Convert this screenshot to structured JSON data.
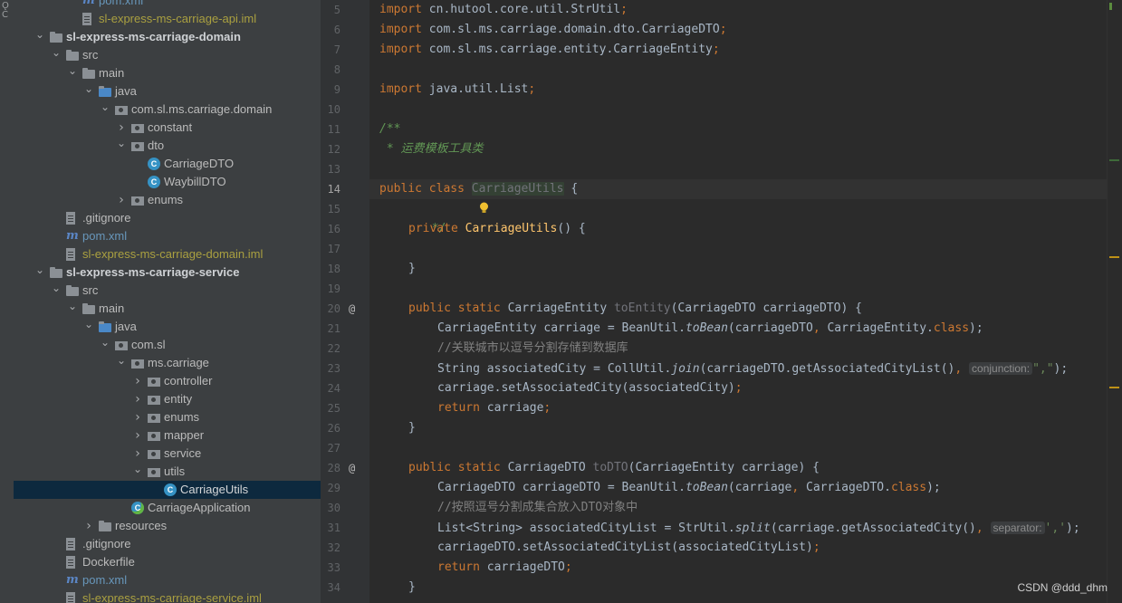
{
  "tool_strip": {
    "glyph": "Ǫ C"
  },
  "project_tree": {
    "rows": [
      {
        "label": "pom.xml",
        "icon": "maven-icon",
        "style": "blue"
      },
      {
        "label": "sl-express-ms-carriage-api.iml",
        "icon": "iml-file-icon",
        "style": "yellow"
      },
      {
        "label": "sl-express-ms-carriage-domain",
        "icon": "module-folder-icon",
        "style": "bold",
        "expanded": true
      },
      {
        "label": "src",
        "icon": "folder-icon",
        "expanded": true
      },
      {
        "label": "main",
        "icon": "folder-icon",
        "expanded": true
      },
      {
        "label": "java",
        "icon": "source-folder-icon",
        "expanded": true
      },
      {
        "label": "com.sl.ms.carriage.domain",
        "icon": "package-icon",
        "expanded": true
      },
      {
        "label": "constant",
        "icon": "package-icon",
        "expanded": false
      },
      {
        "label": "dto",
        "icon": "package-icon",
        "expanded": true
      },
      {
        "label": "CarriageDTO",
        "icon": "class-icon"
      },
      {
        "label": "WaybillDTO",
        "icon": "class-icon"
      },
      {
        "label": "enums",
        "icon": "package-icon",
        "expanded": false
      },
      {
        "label": ".gitignore",
        "icon": "gitignore-file-icon"
      },
      {
        "label": "pom.xml",
        "icon": "maven-icon",
        "style": "blue"
      },
      {
        "label": "sl-express-ms-carriage-domain.iml",
        "icon": "iml-file-icon",
        "style": "yellow"
      },
      {
        "label": "sl-express-ms-carriage-service",
        "icon": "module-folder-icon",
        "style": "bold",
        "expanded": true
      },
      {
        "label": "src",
        "icon": "folder-icon",
        "expanded": true
      },
      {
        "label": "main",
        "icon": "folder-icon",
        "expanded": true
      },
      {
        "label": "java",
        "icon": "source-folder-icon",
        "expanded": true
      },
      {
        "label": "com.sl",
        "icon": "package-icon",
        "expanded": true
      },
      {
        "label": "ms.carriage",
        "icon": "package-icon",
        "expanded": true
      },
      {
        "label": "controller",
        "icon": "package-icon",
        "expanded": false
      },
      {
        "label": "entity",
        "icon": "package-icon",
        "expanded": false
      },
      {
        "label": "enums",
        "icon": "package-icon",
        "expanded": false
      },
      {
        "label": "mapper",
        "icon": "package-icon",
        "expanded": false
      },
      {
        "label": "service",
        "icon": "package-icon",
        "expanded": false
      },
      {
        "label": "utils",
        "icon": "package-icon",
        "expanded": true
      },
      {
        "label": "CarriageUtils",
        "icon": "class-icon",
        "selected": true
      },
      {
        "label": "CarriageApplication",
        "icon": "spring-app-class-icon"
      },
      {
        "label": "resources",
        "icon": "resources-folder-icon",
        "expanded": false
      },
      {
        "label": ".gitignore",
        "icon": "gitignore-file-icon"
      },
      {
        "label": "Dockerfile",
        "icon": "docker-file-icon"
      },
      {
        "label": "pom.xml",
        "icon": "maven-icon",
        "style": "blue"
      },
      {
        "label": "sl-express-ms-carriage-service.iml",
        "icon": "iml-file-icon",
        "style": "yellow"
      }
    ]
  },
  "editor": {
    "active_line": "14",
    "line_numbers": [
      "5",
      "6",
      "7",
      "8",
      "9",
      "10",
      "11",
      "12",
      "13",
      "14",
      "15",
      "16",
      "17",
      "18",
      "19",
      "20",
      "21",
      "22",
      "23",
      "24",
      "25",
      "26",
      "27",
      "28",
      "29",
      "30",
      "31",
      "32",
      "33",
      "34"
    ],
    "gutter_markers": {
      "20": "@",
      "28": "@"
    },
    "code": {
      "l5_a": "import",
      "l5_b": " cn.hutool.core.util.StrUtil",
      "l5_c": ";",
      "l6_a": "import",
      "l6_b": " com.sl.ms.carriage.domain.dto.CarriageDTO",
      "l6_c": ";",
      "l7": "",
      "l8": "",
      "l9_a": "import",
      "l9_b": " java.util.List",
      "l9_c": ";",
      "l10": "",
      "l11": "/**",
      "l12": " * 运费模板工具类",
      "l13": " */",
      "l14_a": "public class",
      "l14_b": "CarriageUtils",
      "l14_c": " {",
      "l15": "",
      "l16_a": "private",
      "l16_b": "CarriageUtils",
      "l16_c": "() {",
      "l17": "",
      "l18": "}",
      "l19": "",
      "l20_a": "public static",
      "l20_b": " CarriageEntity ",
      "l20_c": "toEntity",
      "l20_d": "(CarriageDTO carriageDTO) {",
      "l21_a": "CarriageEntity carriage = BeanUtil.",
      "l21_b": "toBean",
      "l21_c": "(carriageDTO",
      "l21_d": ",",
      "l21_e": " CarriageEntity.",
      "l21_f": "class",
      "l21_g": ");",
      "l22": "//关联城市以逗号分割存储到数据库",
      "l23_a": "String associatedCity = CollUtil.",
      "l23_b": "join",
      "l23_c": "(carriageDTO.getAssociatedCityList()",
      "l23_d": ",",
      "l23_hint": "conjunction:",
      "l23_e": "\",\"",
      "l23_f": ");",
      "l24": "carriage.setAssociatedCity(associatedCity)",
      "l24_semi": ";",
      "l25_a": "return",
      "l25_b": " carriage",
      "l25_c": ";",
      "l26": "}",
      "l27": "",
      "l28_a": "public static",
      "l28_b": " CarriageDTO ",
      "l28_c": "toDTO",
      "l28_d": "(CarriageEntity carriage) {",
      "l29_a": "CarriageDTO carriageDTO = BeanUtil.",
      "l29_b": "toBean",
      "l29_c": "(carriage",
      "l29_d": ",",
      "l29_e": " CarriageDTO.",
      "l29_f": "class",
      "l29_g": ");",
      "l30": "//按照逗号分割成集合放入DTO对象中",
      "l31_a": "List<String> associatedCityList = StrUtil.",
      "l31_b": "split",
      "l31_c": "(carriage.getAssociatedCity()",
      "l31_d": ",",
      "l31_hint": "separator:",
      "l31_e": "','",
      "l31_f": ");",
      "l32": "carriageDTO.setAssociatedCityList(associatedCityList)",
      "l32_semi": ";",
      "l33_a": "return",
      "l33_b": " carriageDTO",
      "l33_c": ";",
      "l34": "}",
      "l7b_a": "import",
      "l7b_b": " com.sl.ms.carriage.entity.CarriageEntity",
      "l7b_c": ";"
    }
  },
  "watermark": "CSDN @ddd_dhm",
  "colors": {
    "keyword": "#cc7832",
    "method": "#ffc66d",
    "string": "#6a8759",
    "comment": "#808080",
    "doc_comment": "#629755",
    "field": "#9876aa",
    "selected_row": "#0d293e"
  }
}
